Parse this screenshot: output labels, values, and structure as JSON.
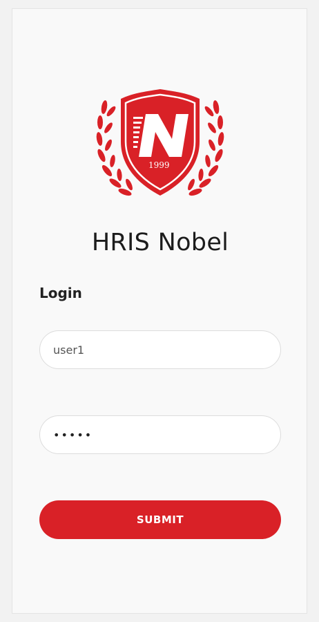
{
  "logo": {
    "letter": "N",
    "year": "1999",
    "icon": "nobel-shield-logo",
    "color": "#d92127"
  },
  "app": {
    "title": "HRIS Nobel"
  },
  "login": {
    "heading": "Login",
    "username_value": "user1",
    "password_value": "•••••",
    "submit_label": "SUBMIT"
  },
  "colors": {
    "accent": "#d92127",
    "background": "#f9f9f9"
  }
}
